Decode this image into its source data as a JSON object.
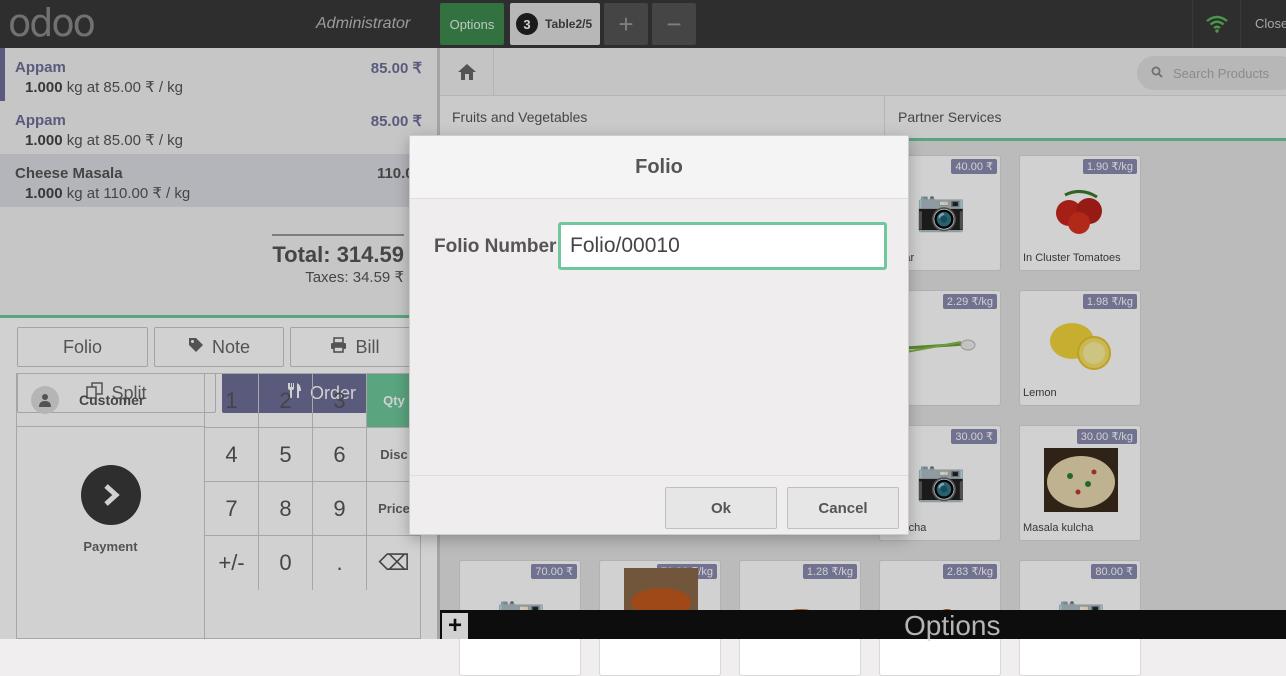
{
  "topbar": {
    "logo": "odoo",
    "user": "Administrator",
    "options_label": "Options",
    "table_count": "3",
    "table_name": "Table2/5",
    "add_order": "+",
    "remove_order": "−",
    "wifi_icon": "wifi-icon",
    "close_label": "Close"
  },
  "order": {
    "lines": [
      {
        "name": "Appam",
        "price": "85.00 ₹",
        "qty": "1.000",
        "detail": "kg at 85.00 ₹ / kg"
      },
      {
        "name": "Appam",
        "price": "85.00 ₹",
        "qty": "1.000",
        "detail": "kg at 85.00 ₹ / kg"
      },
      {
        "name": "Cheese Masala",
        "price": "110.00",
        "qty": "1.000",
        "detail": "kg at 110.00 ₹ / kg"
      }
    ],
    "total": "Total: 314.59",
    "taxes": "Taxes: 34.59 ₹"
  },
  "controls": {
    "folio": "Folio",
    "note": "Note",
    "bill": "Bill",
    "split": "Split",
    "order": "Order"
  },
  "numpad": {
    "customer": "Customer",
    "payment": "Payment",
    "keys": [
      "1",
      "2",
      "3",
      "4",
      "5",
      "6",
      "7",
      "8",
      "9",
      "+/-",
      "0",
      "."
    ],
    "qty": "Qty",
    "disc": "Disc",
    "price": "Price",
    "backspace": "⌫"
  },
  "products_screen": {
    "search_placeholder": "Search Products",
    "categories": [
      "Fruits and Vegetables",
      "Partner Services"
    ],
    "products": [
      {
        "price": "40.00 ₹",
        "name": "ambar"
      },
      {
        "price": "1.90 ₹/kg",
        "name": "In Cluster Tomatoes"
      },
      {
        "price": "2.29 ₹/kg",
        "name": ""
      },
      {
        "price": "1.98 ₹/kg",
        "name": "Lemon"
      },
      {
        "price": "30.00 ₹",
        "name": "la kulcha"
      },
      {
        "price": "30.00 ₹/kg",
        "name": "Masala kulcha"
      },
      {
        "price": "70.00 ₹",
        "name": ""
      },
      {
        "price": "70.00 ₹/kg",
        "name": ""
      },
      {
        "price": "1.28 ₹/kg",
        "name": ""
      },
      {
        "price": "2.83 ₹/kg",
        "name": ""
      },
      {
        "price": "80.00 ₹",
        "name": ""
      }
    ],
    "bottom_plus": "+",
    "bottom_options": "Options"
  },
  "dialog": {
    "title": "Folio",
    "field_label": "Folio Number",
    "field_value": "Folio/00010",
    "ok": "Ok",
    "cancel": "Cancel"
  },
  "colors": {
    "accent_green": "#6ec89b",
    "order_purple": "#6e6e99",
    "topbar": "#393939"
  }
}
